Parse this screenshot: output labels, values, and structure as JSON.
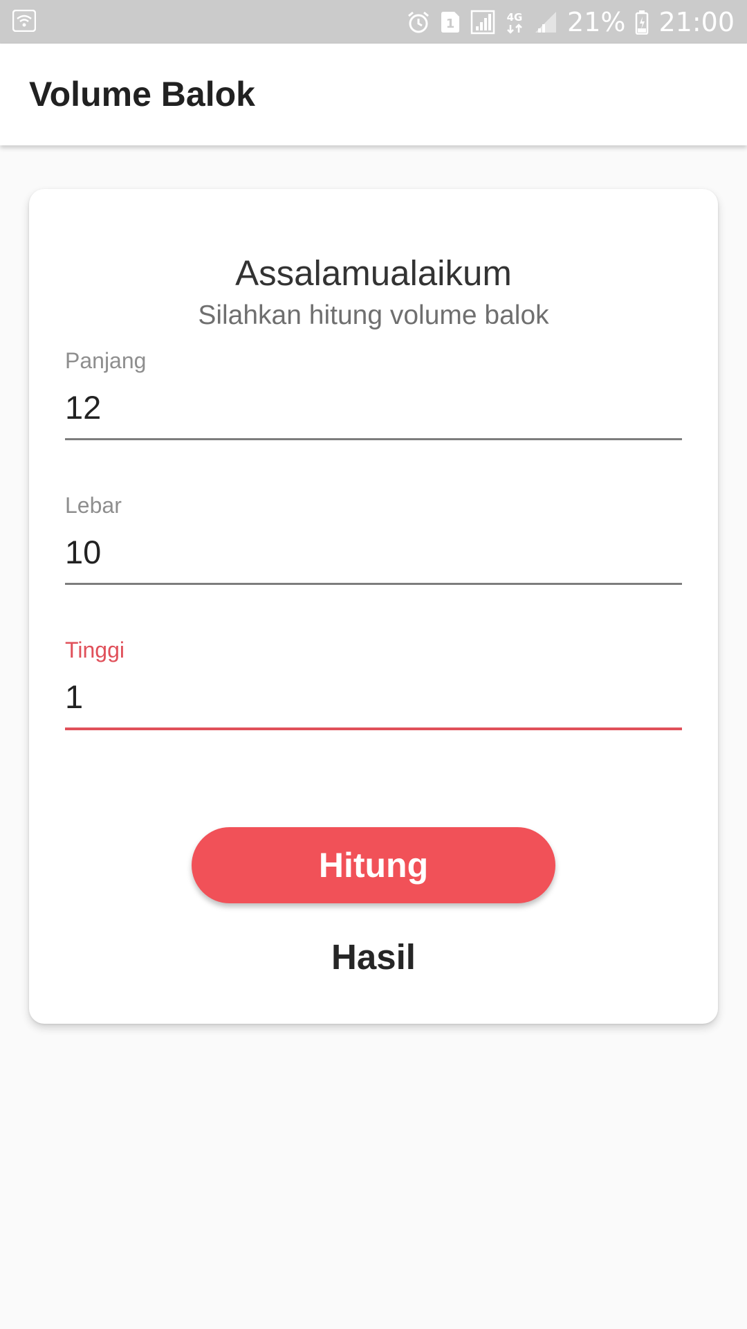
{
  "status_bar": {
    "battery": "21%",
    "time": "21:00",
    "network": "4G",
    "sim_slot": "1",
    "icons": [
      "wifi-icon",
      "alarm-icon",
      "sim-icon",
      "signal-icon",
      "network-4g-icon",
      "signal-weak-icon",
      "battery-charging-icon"
    ]
  },
  "app_bar": {
    "title": "Volume Balok"
  },
  "card": {
    "greeting": "Assalamualaikum",
    "subtitle": "Silahkan hitung volume balok",
    "fields": [
      {
        "label": "Panjang",
        "value": "12"
      },
      {
        "label": "Lebar",
        "value": "10"
      },
      {
        "label": "Tinggi",
        "value": "1",
        "focused": true
      }
    ],
    "button_label": "Hitung",
    "result_label": "Hasil"
  },
  "colors": {
    "accent": "#f15158",
    "focus_label": "#e0505a",
    "status_bar_bg": "#cbcbcb",
    "background": "#fafafa"
  }
}
